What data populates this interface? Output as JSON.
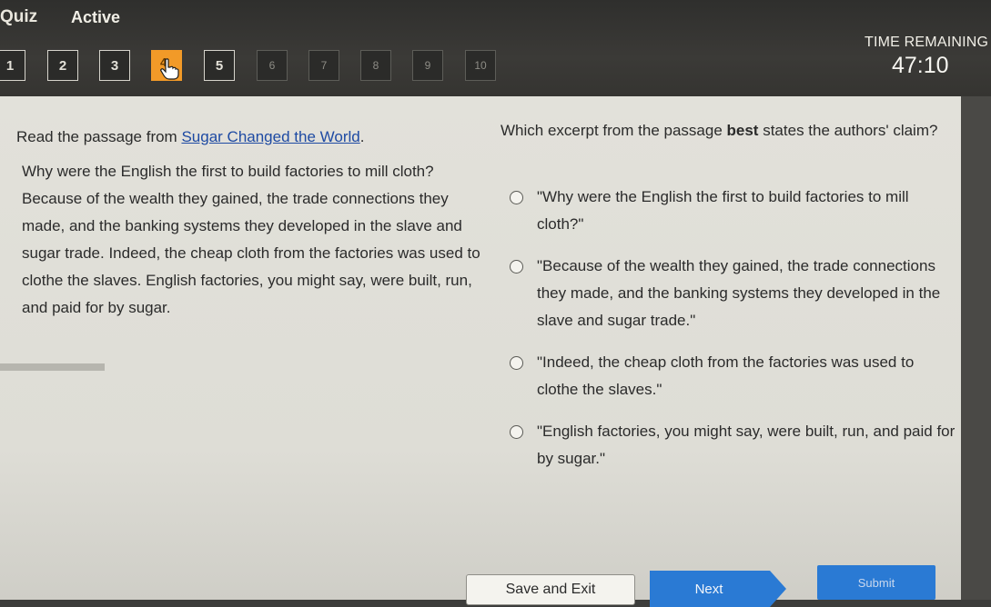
{
  "header": {
    "brand": "Quiz",
    "status": "Active",
    "timer_label": "TIME REMAINING",
    "timer_value": "47:10"
  },
  "question_nav": [
    {
      "label": "1",
      "state": "answered"
    },
    {
      "label": "2",
      "state": "answered"
    },
    {
      "label": "3",
      "state": "answered"
    },
    {
      "label": "4",
      "state": "current"
    },
    {
      "label": "5",
      "state": "answered"
    },
    {
      "label": "6",
      "state": "unanswered"
    },
    {
      "label": "7",
      "state": "unanswered"
    },
    {
      "label": "8",
      "state": "unanswered"
    },
    {
      "label": "9",
      "state": "unanswered"
    },
    {
      "label": "10",
      "state": "unanswered"
    }
  ],
  "passage": {
    "intro_prefix": "Read the passage from ",
    "source_title": "Sugar Changed the World",
    "intro_suffix": ".",
    "text": "Why were the English the first to build factories to mill cloth? Because of the wealth they gained, the trade connections they made, and the banking systems they developed in the slave and sugar trade. Indeed, the cheap cloth from the factories was used to clothe the slaves. English factories, you might say, were built, run, and paid for by sugar."
  },
  "question": {
    "prefix": "Which excerpt from the passage ",
    "emphasis": "best",
    "suffix": " states the authors' claim?",
    "options": [
      "\"Why were the English the first to build factories to mill cloth?\"",
      "\"Because of the wealth they gained, the trade connections they made, and the banking systems they developed in the slave and sugar trade.\"",
      "\"Indeed, the cheap cloth from the factories was used to clothe the slaves.\"",
      "\"English factories, you might say, were built, run, and paid for by sugar.\""
    ]
  },
  "footer": {
    "save_exit": "Save and Exit",
    "next": "Next",
    "submit": "Submit"
  },
  "colors": {
    "current_question": "#f29a28",
    "primary_button": "#2a7ad4",
    "link": "#1e4aa3"
  }
}
